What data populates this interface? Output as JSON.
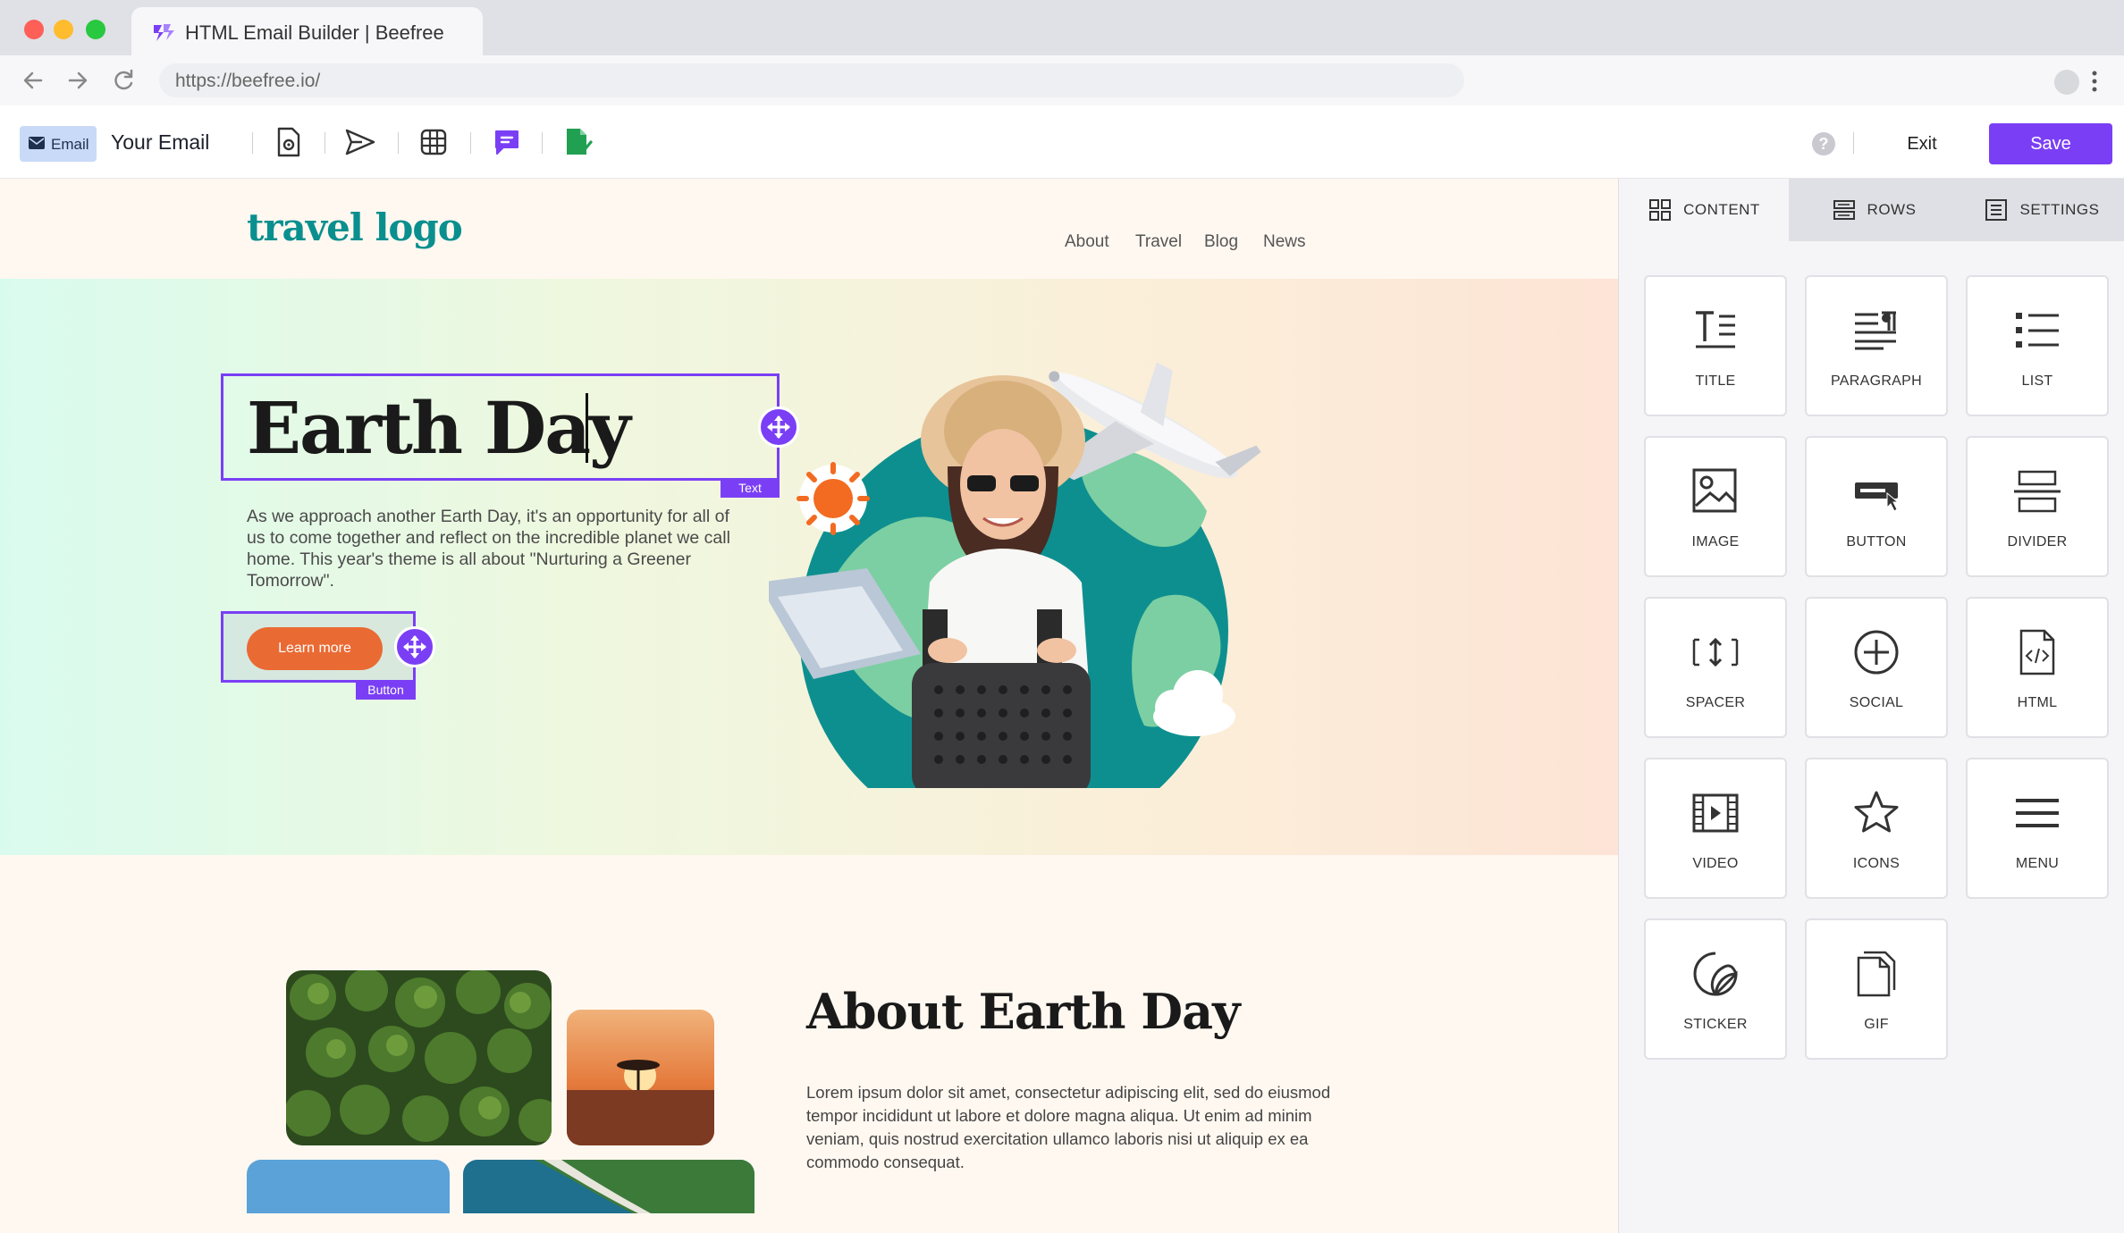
{
  "browser": {
    "tab_title": "HTML Email Builder | Beefree",
    "url": "https://beefree.io/"
  },
  "toolbar": {
    "chip_label": "Email",
    "email_name": "Your Email",
    "exit_label": "Exit",
    "save_label": "Save",
    "help_glyph": "?"
  },
  "email": {
    "logo": "travel logo",
    "nav": [
      "About",
      "Travel",
      "Blog",
      "News"
    ],
    "hero": {
      "headline": "Earth Day",
      "paragraph": "As we approach another Earth Day, it's an opportunity for all of us to come together and reflect on the incredible planet we call home. This year's theme is all about \"Nurturing a Greener Tomorrow\".",
      "button_label": "Learn more",
      "text_tag": "Text",
      "button_tag": "Button"
    },
    "about": {
      "title": "About Earth Day",
      "paragraph": "Lorem ipsum dolor sit amet, consectetur adipiscing elit, sed do eiusmod tempor incididunt ut labore et dolore magna aliqua. Ut enim ad minim veniam, quis nostrud exercitation ullamco laboris nisi ut aliquip ex ea commodo consequat."
    }
  },
  "panel": {
    "tabs": [
      "CONTENT",
      "ROWS",
      "SETTINGS"
    ],
    "active_tab": "CONTENT",
    "blocks": [
      "TITLE",
      "PARAGRAPH",
      "LIST",
      "IMAGE",
      "BUTTON",
      "DIVIDER",
      "SPACER",
      "SOCIAL",
      "HTML",
      "VIDEO",
      "ICONS",
      "MENU",
      "STICKER",
      "GIF"
    ]
  },
  "colors": {
    "accent": "#7a3ff5",
    "logo": "#0a8f8f",
    "cta": "#ea6a33"
  }
}
